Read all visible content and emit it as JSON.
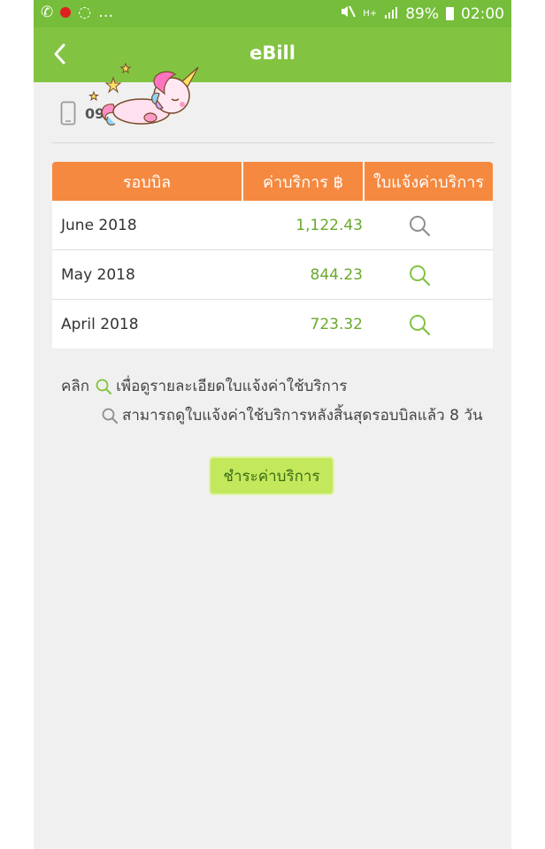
{
  "status_bar": {
    "battery": "89%",
    "time": "02:00",
    "network": "H+"
  },
  "header": {
    "title": "eBill"
  },
  "account": {
    "phone_number": "09"
  },
  "table": {
    "columns": [
      "รอบบิล",
      "ค่าบริการ ฿",
      "ใบแจ้งค่าบริการ"
    ],
    "rows": [
      {
        "period": "June 2018",
        "amount": "1,122.43",
        "icon_color": "#8f8f8f"
      },
      {
        "period": "May 2018",
        "amount": "844.23",
        "icon_color": "#82c341"
      },
      {
        "period": "April 2018",
        "amount": "723.32",
        "icon_color": "#82c341"
      }
    ]
  },
  "notes": {
    "line1_prefix": "คลิก",
    "line1_text": "เพื่อดูรายละเอียดใบแจ้งค่าใช้บริการ",
    "line2_text": "สามารถดูใบแจ้งค่าใช้บริการหลังสิ้นสุดรอบบิลแล้ว 8 วัน"
  },
  "pay_button": {
    "label": "ชำระค่าบริการ"
  },
  "colors": {
    "header": "#82c341",
    "table_header": "#f5893f",
    "amount": "#69a92c",
    "button": "#c3e85b"
  }
}
